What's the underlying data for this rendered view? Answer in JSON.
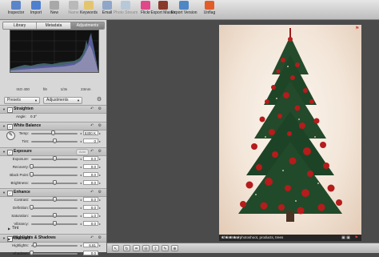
{
  "toolbar": {
    "items": [
      {
        "label": "Inspector",
        "icon": "info-icon",
        "color": "#5b84c9",
        "enabled": true
      },
      {
        "label": "Import",
        "icon": "import-icon",
        "color": "#4f7fcf",
        "enabled": true
      },
      {
        "label": "New",
        "icon": "new-icon",
        "color": "#a8a8a8",
        "enabled": true
      },
      {
        "label": "Name",
        "icon": "name-icon",
        "color": "#b9b9b9",
        "enabled": false
      },
      {
        "label": "Keywords",
        "icon": "keywords-icon",
        "color": "#e4c56f",
        "enabled": true
      },
      {
        "label": "Email",
        "icon": "email-icon",
        "color": "#8fa6c7",
        "enabled": true
      },
      {
        "label": "Photo Stream",
        "icon": "photo-stream-icon",
        "color": "#b7c8d8",
        "enabled": false
      },
      {
        "label": "Flickr",
        "icon": "flickr-icon",
        "color": "#e0478a",
        "enabled": true
      },
      {
        "label": "Export Master",
        "icon": "export-master-icon",
        "color": "#8a3a2a",
        "enabled": true
      },
      {
        "label": "Export Version",
        "icon": "export-version-icon",
        "color": "#4f86c6",
        "enabled": true
      },
      {
        "label": "Unflag",
        "icon": "unflag-icon",
        "color": "#e25c2a",
        "enabled": true
      }
    ]
  },
  "panel": {
    "tabs": [
      "Library",
      "Metadata",
      "Adjustments"
    ],
    "active_tab": "Adjustments",
    "histogram_info": [
      "ISO 400",
      "f/8",
      "1/3s",
      "23mm"
    ],
    "presets_label": "Presets",
    "adjustments_label": "Adjustments",
    "sections": {
      "straighten": {
        "title": "Straighten",
        "angle_label": "Angle:",
        "angle_value": "0.3°"
      },
      "white_balance": {
        "title": "White Balance",
        "rows": [
          {
            "label": "Temp:",
            "value": "5300 K",
            "level": 0.47
          },
          {
            "label": "Tint:",
            "value": "0",
            "level": 0.5
          }
        ]
      },
      "exposure": {
        "title": "Exposure",
        "auto_label": "Auto",
        "rows": [
          {
            "label": "Exposure:",
            "value": "0.0",
            "level": 0.5
          },
          {
            "label": "Recovery:",
            "value": "0.0",
            "level": 0.0
          },
          {
            "label": "Black Point:",
            "value": "0.0",
            "level": 0.0
          },
          {
            "label": "Brightness:",
            "value": "0.0",
            "level": 0.5
          }
        ]
      },
      "enhance": {
        "title": "Enhance",
        "rows": [
          {
            "label": "Contrast:",
            "value": "0.0",
            "level": 0.5
          },
          {
            "label": "Definition:",
            "value": "0.0",
            "level": 0.0
          },
          {
            "label": "Saturation:",
            "value": "1.0",
            "level": 0.5
          },
          {
            "label": "Vibrancy:",
            "value": "0.0",
            "level": 0.5
          }
        ],
        "tint_label": "Tint"
      },
      "highlights_shadows": {
        "title": "Highlights & Shadows",
        "rows": [
          {
            "label": "Highlights:",
            "value": "6.81",
            "level": 0.07
          },
          {
            "label": "Shadows:",
            "value": "0.0",
            "level": 0.0
          }
        ],
        "advanced_label": "Advanced"
      }
    }
  },
  "viewer": {
    "rating_stars": "★★★★★",
    "keywords": "christmas, photoshoot, products, trees"
  }
}
